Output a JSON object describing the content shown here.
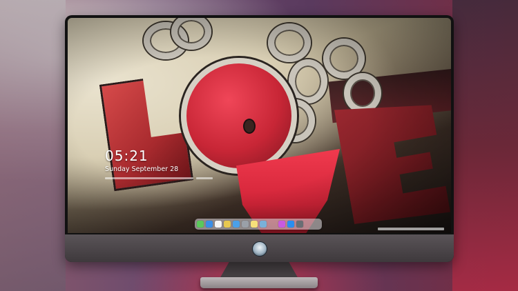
{
  "lock_screen": {
    "time": "05:21",
    "date": "Sunday September  28"
  },
  "dock": {
    "apps": [
      {
        "name": "messages-icon",
        "color": "#5ac85a"
      },
      {
        "name": "weather-icon",
        "color": "#3a8ee6"
      },
      {
        "name": "clock-icon",
        "color": "#f4f4f4"
      },
      {
        "name": "photos-icon",
        "color": "#e8c850"
      },
      {
        "name": "finder-icon",
        "color": "#4aa0e8"
      },
      {
        "name": "calculator-icon",
        "color": "#9aa0a8"
      },
      {
        "name": "notes-icon",
        "color": "#f6e07a"
      },
      {
        "name": "preview-icon",
        "color": "#7ab0d8"
      },
      {
        "name": "music-icon",
        "color": "#c85ae0"
      },
      {
        "name": "app-store-icon",
        "color": "#2a8ef0"
      },
      {
        "name": "screenshot-icon",
        "color": "#6a6e74"
      }
    ]
  },
  "colors": {
    "accent_red": "#d22438",
    "monitor_bezel": "#111111",
    "chin": "#4a4548"
  }
}
